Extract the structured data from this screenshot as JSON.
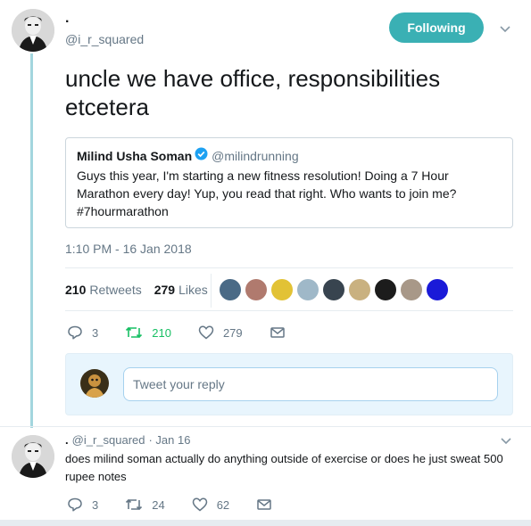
{
  "tweet": {
    "author_name": ".",
    "author_handle": "@i_r_squared",
    "follow_label": "Following",
    "text": "uncle we have office, responsibilities etcetera",
    "timestamp": "1:10 PM - 16 Jan 2018",
    "retweets_count": "210",
    "retweets_label": "Retweets",
    "likes_count": "279",
    "likes_label": "Likes",
    "actions": {
      "reply_count": "3",
      "retweet_count": "210",
      "like_count": "279"
    }
  },
  "quoted": {
    "name": "Milind Usha Soman",
    "handle": "@milindrunning",
    "text": "Guys this year, I'm starting a new fitness resolution! Doing a 7 Hour Marathon every day! Yup, you read that right. Who wants to join me? #7hourmarathon"
  },
  "likers": [
    {
      "name": "liker-1",
      "color": "#4a6a86"
    },
    {
      "name": "liker-2",
      "color": "#b07a6e"
    },
    {
      "name": "liker-3",
      "color": "#e2c235"
    },
    {
      "name": "liker-4",
      "color": "#9fb8c8"
    },
    {
      "name": "liker-5",
      "color": "#38444f"
    },
    {
      "name": "liker-6",
      "color": "#c9b180"
    },
    {
      "name": "liker-7",
      "color": "#1c1c1c"
    },
    {
      "name": "liker-8",
      "color": "#a89888"
    },
    {
      "name": "liker-9",
      "color": "#1a1ad8"
    }
  ],
  "reply_composer": {
    "placeholder": "Tweet your reply"
  },
  "reply": {
    "author_name": ".",
    "author_handle": "@i_r_squared",
    "date": "· Jan 16",
    "text": "does milind soman actually do anything outside of exercise or does he just sweat 500 rupee notes",
    "reply_count": "3",
    "retweet_count": "24",
    "like_count": "62"
  },
  "colors": {
    "accent": "#3ab0b4",
    "retweet_green": "#17bf63",
    "verified_blue": "#1da1f2",
    "thread_line": "#a3d6de"
  }
}
